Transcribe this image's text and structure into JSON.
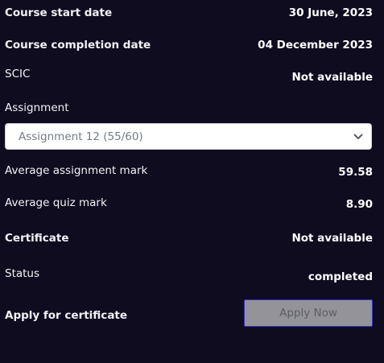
{
  "course_info": {
    "start_date": {
      "label": "Course start date",
      "value": "30 June, 2023"
    },
    "completion_date": {
      "label": "Course completion date",
      "value": "04 December 2023"
    },
    "scic": {
      "label": "SCIC",
      "value": "Not available"
    }
  },
  "assignment": {
    "label": "Assignment",
    "selected": "Assignment 12 (55/60)",
    "chevron_icon": "chevron-down-icon"
  },
  "marks": {
    "average_assignment": {
      "label": "Average assignment mark",
      "value": "59.58"
    },
    "average_quiz": {
      "label": "Average quiz mark",
      "value": "8.90"
    }
  },
  "certificate": {
    "label": "Certificate",
    "value": "Not available"
  },
  "status": {
    "label": "Status",
    "value": "completed"
  },
  "apply": {
    "label": "Apply for certificate",
    "button_label": "Apply Now"
  },
  "colors": {
    "background": "#0f0c20",
    "text": "#ffffff",
    "select_text": "#737b88",
    "button_fill": "#939399",
    "button_border": "#3b33c9",
    "button_text": "#5d5d66"
  }
}
